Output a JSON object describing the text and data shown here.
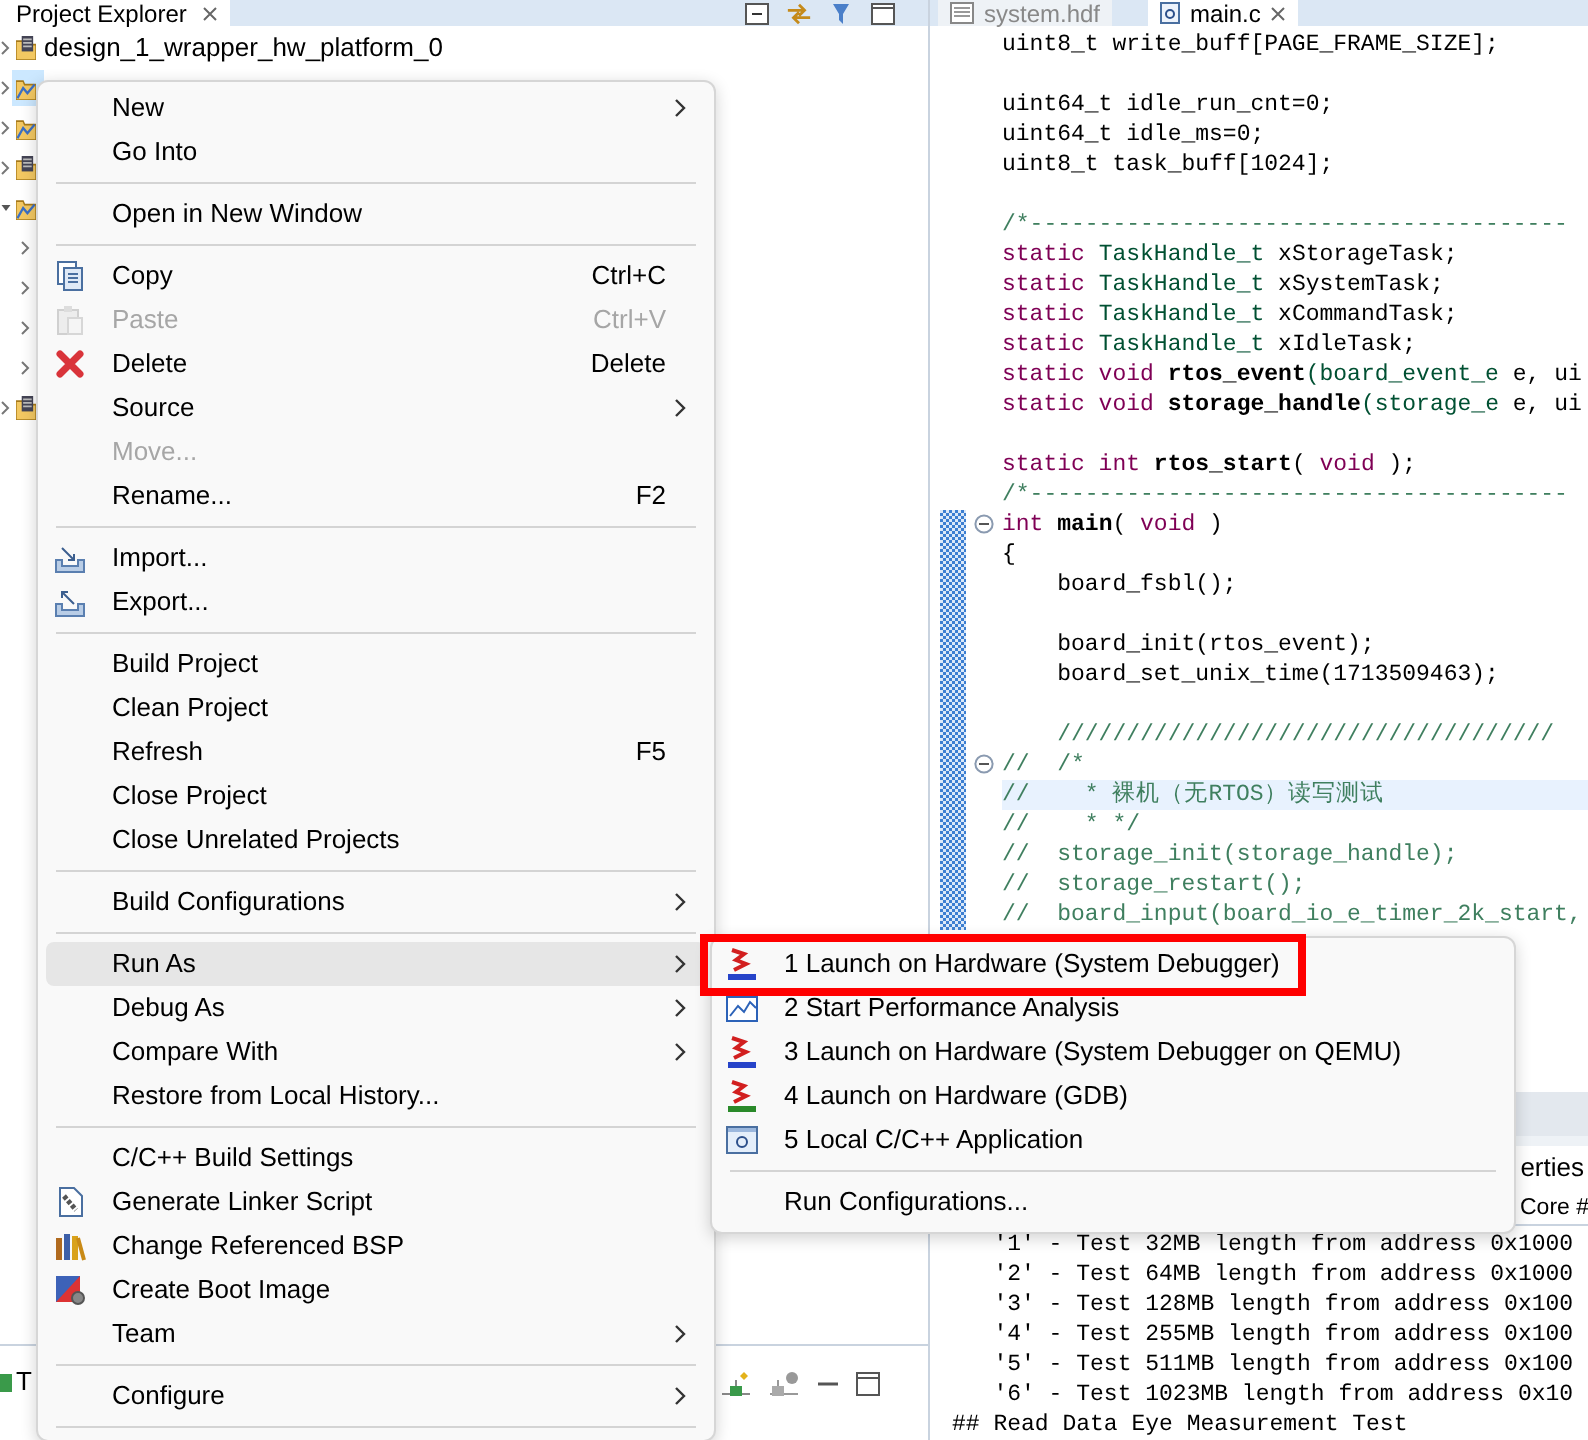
{
  "explorer": {
    "tab": "Project Explorer",
    "tree": [
      {
        "label": "design_1_wrapper_hw_platform_0",
        "selected": false,
        "expanded": false
      },
      {
        "selected": true,
        "expanded": false
      },
      {
        "selected": false,
        "expanded": false
      },
      {
        "selected": false,
        "expanded": false
      },
      {
        "selected": false,
        "expanded": true,
        "children": [
          {
            "expanded": false
          },
          {
            "expanded": false
          },
          {
            "expanded": false
          },
          {
            "expanded": false
          }
        ]
      },
      {
        "selected": false,
        "expanded": false
      }
    ],
    "bottom_tab": "T"
  },
  "editor": {
    "tabs": [
      {
        "label": "system.hdf",
        "selected": false
      },
      {
        "label": "main.c",
        "selected": true
      }
    ],
    "lines": [
      {
        "kind": "code",
        "changed": false,
        "tokens": [
          {
            "kind": "plain",
            "text": "uint8_t write_buff[PAGE_FRAME_SIZE];"
          }
        ]
      },
      {
        "kind": "blank",
        "changed": false
      },
      {
        "kind": "code",
        "changed": false,
        "tokens": [
          {
            "kind": "plain",
            "text": "uint64_t idle_run_cnt=0;"
          }
        ]
      },
      {
        "kind": "code",
        "changed": false,
        "tokens": [
          {
            "kind": "plain",
            "text": "uint64_t idle_ms=0;"
          }
        ]
      },
      {
        "kind": "code",
        "changed": false,
        "tokens": [
          {
            "kind": "plain",
            "text": "uint8_t task_buff[1024];"
          }
        ]
      },
      {
        "kind": "blank",
        "changed": false
      },
      {
        "kind": "code",
        "changed": false,
        "tokens": [
          {
            "kind": "comment",
            "text": "/*---------------------------------------"
          }
        ]
      },
      {
        "kind": "code",
        "changed": false,
        "tokens": [
          {
            "kind": "keyword",
            "text": "static "
          },
          {
            "kind": "type",
            "text": "TaskHandle_t"
          },
          {
            "kind": "plain",
            "text": " xStorageTask;"
          }
        ]
      },
      {
        "kind": "code",
        "changed": false,
        "tokens": [
          {
            "kind": "keyword",
            "text": "static "
          },
          {
            "kind": "type",
            "text": "TaskHandle_t"
          },
          {
            "kind": "plain",
            "text": " xSystemTask;"
          }
        ]
      },
      {
        "kind": "code",
        "changed": false,
        "tokens": [
          {
            "kind": "keyword",
            "text": "static "
          },
          {
            "kind": "type",
            "text": "TaskHandle_t"
          },
          {
            "kind": "plain",
            "text": " xCommandTask;"
          }
        ]
      },
      {
        "kind": "code",
        "changed": false,
        "tokens": [
          {
            "kind": "keyword",
            "text": "static "
          },
          {
            "kind": "type",
            "text": "TaskHandle_t"
          },
          {
            "kind": "plain",
            "text": " xIdleTask;"
          }
        ]
      },
      {
        "kind": "code",
        "changed": false,
        "tokens": [
          {
            "kind": "keyword",
            "text": "static void "
          },
          {
            "kind": "function",
            "text": "rtos_event"
          },
          {
            "kind": "type",
            "text": "(board_event_e"
          },
          {
            "kind": "plain",
            "text": " e, ui"
          }
        ]
      },
      {
        "kind": "code",
        "changed": false,
        "tokens": [
          {
            "kind": "keyword",
            "text": "static void "
          },
          {
            "kind": "function",
            "text": "storage_handle"
          },
          {
            "kind": "type",
            "text": "(storage_e"
          },
          {
            "kind": "plain",
            "text": " e, ui"
          }
        ]
      },
      {
        "kind": "blank",
        "changed": false
      },
      {
        "kind": "code",
        "changed": false,
        "tokens": [
          {
            "kind": "keyword",
            "text": "static int "
          },
          {
            "kind": "function",
            "text": "rtos_start"
          },
          {
            "kind": "plain",
            "text": "( "
          },
          {
            "kind": "keyword",
            "text": "void"
          },
          {
            "kind": "plain",
            "text": " );"
          }
        ]
      },
      {
        "kind": "code",
        "changed": false,
        "tokens": [
          {
            "kind": "comment",
            "text": "/*---------------------------------------"
          }
        ]
      },
      {
        "kind": "fold-start",
        "changed": true,
        "tokens": [
          {
            "kind": "keyword",
            "text": "int "
          },
          {
            "kind": "function",
            "text": "main"
          },
          {
            "kind": "plain",
            "text": "( "
          },
          {
            "kind": "keyword",
            "text": "void"
          },
          {
            "kind": "plain",
            "text": " )"
          }
        ]
      },
      {
        "kind": "code",
        "changed": true,
        "tokens": [
          {
            "kind": "plain",
            "text": "{"
          }
        ]
      },
      {
        "kind": "code",
        "changed": true,
        "tokens": [
          {
            "kind": "plain",
            "text": "    board_fsbl();"
          }
        ]
      },
      {
        "kind": "blank",
        "changed": true
      },
      {
        "kind": "code",
        "changed": true,
        "tokens": [
          {
            "kind": "plain",
            "text": "    board_init(rtos_event);"
          }
        ]
      },
      {
        "kind": "code",
        "changed": true,
        "tokens": [
          {
            "kind": "plain",
            "text": "    board_set_unix_time(1713509463);"
          }
        ]
      },
      {
        "kind": "blank",
        "changed": true
      },
      {
        "kind": "code",
        "changed": true,
        "tokens": [
          {
            "kind": "comment",
            "text": "    ////////////////////////////////////"
          }
        ]
      },
      {
        "kind": "fold-start",
        "changed": true,
        "tokens": [
          {
            "kind": "comment",
            "text": "//  /*"
          }
        ]
      },
      {
        "kind": "current-line",
        "changed": true,
        "tokens": [
          {
            "kind": "comment",
            "text": "//    * 裸机（无RTOS）读写测试"
          }
        ]
      },
      {
        "kind": "code",
        "changed": true,
        "tokens": [
          {
            "kind": "comment",
            "text": "//    * */"
          }
        ]
      },
      {
        "kind": "code",
        "changed": true,
        "tokens": [
          {
            "kind": "comment",
            "text": "//  storage_init(storage_handle);"
          }
        ]
      },
      {
        "kind": "code",
        "changed": true,
        "tokens": [
          {
            "kind": "comment",
            "text": "//  storage_restart();"
          }
        ]
      },
      {
        "kind": "code",
        "changed": true,
        "tokens": [
          {
            "kind": "comment",
            "text": "//  board_input(board_io_e_timer_2k_start,"
          }
        ]
      }
    ]
  },
  "console": {
    "panel_tab": "erties",
    "title": "Core #",
    "lines": [
      "   '1' - Test 32MB length from address 0x1000",
      "   '2' - Test 64MB length from address 0x1000",
      "   '3' - Test 128MB length from address 0x100",
      "   '4' - Test 255MB length from address 0x100",
      "   '5' - Test 511MB length from address 0x100",
      "   '6' - Test 1023MB length from address 0x10",
      "## Read Data Eye Measurement Test"
    ]
  },
  "context_menu": {
    "items": [
      {
        "kind": "item",
        "label": "New",
        "submenu": true,
        "disabled": false,
        "selected": false
      },
      {
        "kind": "item",
        "label": "Go Into",
        "submenu": false,
        "disabled": false,
        "selected": false
      },
      {
        "kind": "separator"
      },
      {
        "kind": "item",
        "label": "Open in New Window",
        "submenu": false,
        "disabled": false,
        "selected": false
      },
      {
        "kind": "separator"
      },
      {
        "kind": "item",
        "label": "Copy",
        "shortcut": "Ctrl+C",
        "submenu": false,
        "disabled": false,
        "selected": false
      },
      {
        "kind": "item",
        "label": "Paste",
        "shortcut": "Ctrl+V",
        "submenu": false,
        "disabled": true,
        "selected": false
      },
      {
        "kind": "item",
        "label": "Delete",
        "shortcut": "Delete",
        "submenu": false,
        "disabled": false,
        "selected": false
      },
      {
        "kind": "item",
        "label": "Source",
        "submenu": true,
        "disabled": false,
        "selected": false
      },
      {
        "kind": "item",
        "label": "Move...",
        "submenu": false,
        "disabled": true,
        "selected": false
      },
      {
        "kind": "item",
        "label": "Rename...",
        "shortcut": "F2",
        "submenu": false,
        "disabled": false,
        "selected": false
      },
      {
        "kind": "separator"
      },
      {
        "kind": "item",
        "label": "Import...",
        "submenu": false,
        "disabled": false,
        "selected": false
      },
      {
        "kind": "item",
        "label": "Export...",
        "submenu": false,
        "disabled": false,
        "selected": false
      },
      {
        "kind": "separator"
      },
      {
        "kind": "item",
        "label": "Build Project",
        "submenu": false,
        "disabled": false,
        "selected": false
      },
      {
        "kind": "item",
        "label": "Clean Project",
        "submenu": false,
        "disabled": false,
        "selected": false
      },
      {
        "kind": "item",
        "label": "Refresh",
        "shortcut": "F5",
        "submenu": false,
        "disabled": false,
        "selected": false
      },
      {
        "kind": "item",
        "label": "Close Project",
        "submenu": false,
        "disabled": false,
        "selected": false
      },
      {
        "kind": "item",
        "label": "Close Unrelated Projects",
        "submenu": false,
        "disabled": false,
        "selected": false
      },
      {
        "kind": "separator"
      },
      {
        "kind": "item",
        "label": "Build Configurations",
        "submenu": true,
        "disabled": false,
        "selected": false
      },
      {
        "kind": "separator"
      },
      {
        "kind": "item",
        "label": "Run As",
        "submenu": true,
        "disabled": false,
        "selected": true
      },
      {
        "kind": "item",
        "label": "Debug As",
        "submenu": true,
        "disabled": false,
        "selected": false
      },
      {
        "kind": "item",
        "label": "Compare With",
        "submenu": true,
        "disabled": false,
        "selected": false
      },
      {
        "kind": "item",
        "label": "Restore from Local History...",
        "submenu": false,
        "disabled": false,
        "selected": false
      },
      {
        "kind": "separator"
      },
      {
        "kind": "item",
        "label": "C/C++ Build Settings",
        "submenu": false,
        "disabled": false,
        "selected": false
      },
      {
        "kind": "item",
        "label": "Generate Linker Script",
        "submenu": false,
        "disabled": false,
        "selected": false
      },
      {
        "kind": "item",
        "label": "Change Referenced BSP",
        "submenu": false,
        "disabled": false,
        "selected": false
      },
      {
        "kind": "item",
        "label": "Create Boot Image",
        "submenu": false,
        "disabled": false,
        "selected": false
      },
      {
        "kind": "item",
        "label": "Team",
        "submenu": true,
        "disabled": false,
        "selected": false
      },
      {
        "kind": "separator"
      },
      {
        "kind": "item",
        "label": "Configure",
        "submenu": true,
        "disabled": false,
        "selected": false
      },
      {
        "kind": "separator"
      }
    ]
  },
  "run_as_submenu": {
    "items": [
      {
        "kind": "item",
        "label": "1 Launch on Hardware (System Debugger)",
        "annotated": true,
        "selected": false
      },
      {
        "kind": "item",
        "label": "2 Start Performance Analysis",
        "annotated": false,
        "selected": false
      },
      {
        "kind": "item",
        "label": "3 Launch on Hardware (System Debugger on QEMU)",
        "annotated": false,
        "selected": false
      },
      {
        "kind": "item",
        "label": "4 Launch on Hardware (GDB)",
        "annotated": false,
        "selected": false
      },
      {
        "kind": "item",
        "label": "5 Local C/C++ Application",
        "annotated": false,
        "selected": false
      },
      {
        "kind": "separator"
      },
      {
        "kind": "item",
        "label": "Run Configurations...",
        "annotated": false,
        "selected": false
      }
    ]
  }
}
